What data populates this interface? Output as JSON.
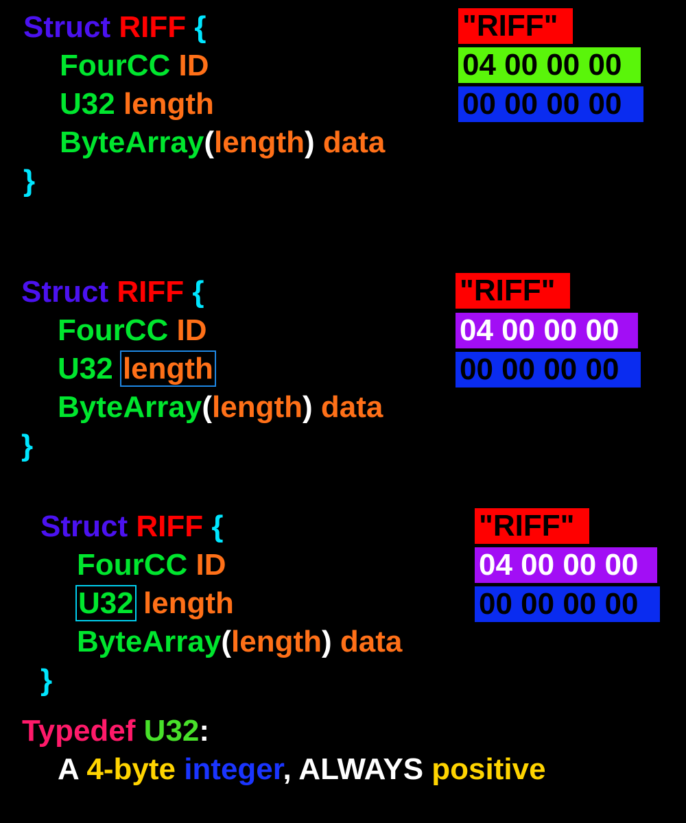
{
  "blocks": [
    {
      "keyword": "Struct",
      "name": "RIFF",
      "open": "{",
      "close": "}",
      "fields": [
        {
          "type": "FourCC",
          "name": "ID"
        },
        {
          "type": "U32",
          "name": "length"
        },
        {
          "type": "ByteArray",
          "lparen": "(",
          "arg": "length",
          "rparen": ")",
          "name": "data"
        }
      ],
      "hex": {
        "magic": "\"RIFF\"",
        "row1": "04 00 00 00",
        "row2": "00 00 00 00"
      }
    },
    {
      "keyword": "Struct",
      "name": "RIFF",
      "open": "{",
      "close": "}",
      "fields": [
        {
          "type": "FourCC",
          "name": "ID"
        },
        {
          "type": "U32",
          "name": "length"
        },
        {
          "type": "ByteArray",
          "lparen": "(",
          "arg": "length",
          "rparen": ")",
          "name": "data"
        }
      ],
      "hex": {
        "magic": "\"RIFF\"",
        "row1": "04 00 00 00",
        "row2": "00 00 00 00"
      }
    },
    {
      "keyword": "Struct",
      "name": "RIFF",
      "open": "{",
      "close": "}",
      "fields": [
        {
          "type": "FourCC",
          "name": "ID"
        },
        {
          "type": "U32",
          "name": "length"
        },
        {
          "type": "ByteArray",
          "lparen": "(",
          "arg": "length",
          "rparen": ")",
          "name": "data"
        }
      ],
      "hex": {
        "magic": "\"RIFF\"",
        "row1": "04 00 00 00",
        "row2": "00 00 00 00"
      }
    }
  ],
  "typedef": {
    "keyword": "Typedef",
    "type": "U32",
    "colon": ":",
    "desc": {
      "a": "A ",
      "size": "4-byte",
      "sp": " ",
      "kind": "integer",
      "rest": ", ALWAYS ",
      "sign": "positive"
    }
  },
  "colors": {
    "keyword": "#4b12f0",
    "name": "#ff0000",
    "brace": "#00e6ff",
    "type": "#00e62e",
    "field": "#ff7018",
    "hex_green": "#5af50a",
    "hex_blue": "#0a2cf0",
    "hex_purple": "#a20ef5"
  }
}
